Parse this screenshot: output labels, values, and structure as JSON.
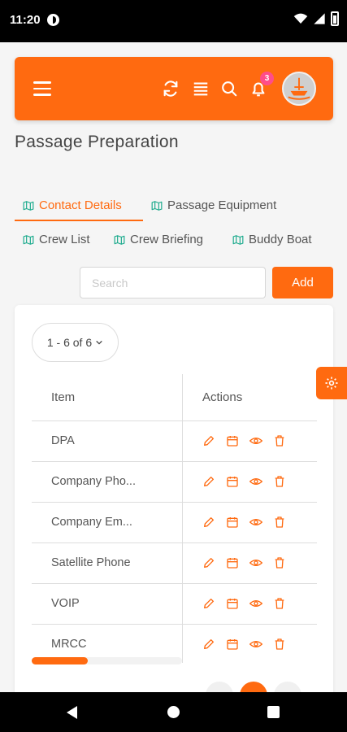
{
  "status_bar": {
    "time": "11:20"
  },
  "header": {
    "notification_count": "3"
  },
  "page": {
    "title": "Passage Preparation"
  },
  "tabs": [
    {
      "label": "Contact Details",
      "active": true
    },
    {
      "label": "Passage Equipment",
      "active": false
    },
    {
      "label": "Crew List",
      "active": false
    },
    {
      "label": "Crew Briefing",
      "active": false
    },
    {
      "label": "Buddy Boat",
      "active": false
    }
  ],
  "search": {
    "placeholder": "Search",
    "value": ""
  },
  "add_button": {
    "label": "Add"
  },
  "pager": {
    "label": "1 - 6 of 6"
  },
  "table": {
    "columns": [
      "Item",
      "Actions"
    ],
    "rows": [
      {
        "item": "DPA"
      },
      {
        "item": "Company Pho..."
      },
      {
        "item": "Company Em..."
      },
      {
        "item": "Satellite Phone"
      },
      {
        "item": "VOIP"
      },
      {
        "item": "MRCC"
      }
    ]
  },
  "colors": {
    "accent": "#ff6a10",
    "badge": "#ff4d8a",
    "tab_icon": "#1aaa8c"
  },
  "icons": [
    "menu-icon",
    "refresh-icon",
    "list-icon",
    "search-icon",
    "bell-icon",
    "map-icon",
    "edit-icon",
    "calendar-icon",
    "eye-icon",
    "trash-icon",
    "settings-icon",
    "chevron-down-icon"
  ]
}
